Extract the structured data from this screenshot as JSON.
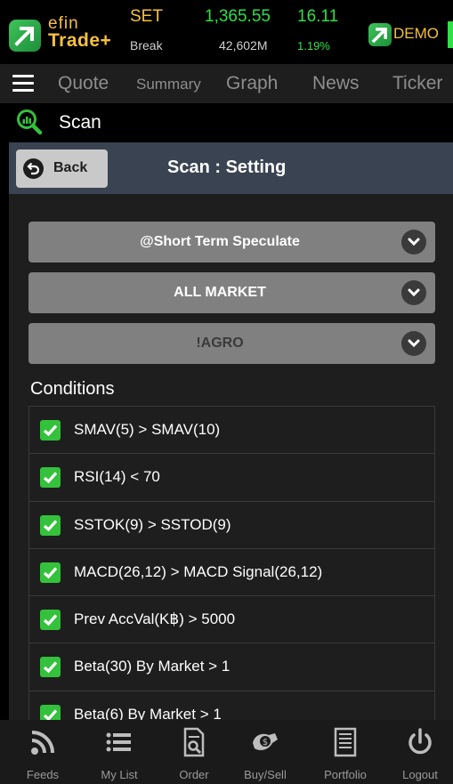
{
  "brand": {
    "efin": "efin",
    "trade": "Trade+",
    "demo": "DEMO"
  },
  "index": {
    "name": "SET",
    "status": "Break",
    "value": "1,365.55",
    "volume": "42,602M",
    "change": "16.11",
    "change_pct": "1.19%"
  },
  "menu": {
    "items": [
      {
        "label": "Quote"
      },
      {
        "label": "Summary"
      },
      {
        "label": "Graph"
      },
      {
        "label": "News"
      },
      {
        "label": "Ticker"
      }
    ]
  },
  "scan": {
    "title": "Scan"
  },
  "setting": {
    "back_label": "Back",
    "title": "Scan : Setting",
    "dropdowns": [
      {
        "value": "@Short Term Speculate"
      },
      {
        "value": "ALL MARKET"
      },
      {
        "value": "!AGRO"
      }
    ],
    "conditions_label": "Conditions",
    "conditions": [
      {
        "text": "SMAV(5) > SMAV(10)",
        "checked": true
      },
      {
        "text": "RSI(14) < 70",
        "checked": true
      },
      {
        "text": "SSTOK(9) > SSTOD(9)",
        "checked": true
      },
      {
        "text": "MACD(26,12) > MACD Signal(26,12)",
        "checked": true
      },
      {
        "text": "Prev AccVal(K฿) > 5000",
        "checked": true
      },
      {
        "text": "Beta(30) By Market > 1",
        "checked": true
      },
      {
        "text": "Beta(6) By Market > 1",
        "checked": true
      }
    ]
  },
  "bottom_nav": {
    "items": [
      {
        "label": "Feeds",
        "icon": "rss-icon"
      },
      {
        "label": "My List",
        "icon": "list-icon"
      },
      {
        "label": "Order",
        "icon": "order-icon"
      },
      {
        "label": "Buy/Sell",
        "icon": "buy-sell-icon"
      },
      {
        "label": "Portfolio",
        "icon": "portfolio-icon"
      },
      {
        "label": "Logout",
        "icon": "power-icon"
      }
    ]
  },
  "colors": {
    "brand_gold": "#f6c13d",
    "up_green": "#2fe046",
    "check_green": "#34c13c",
    "subheader_bg": "#3a4351",
    "dropdown_bg": "#808080"
  }
}
